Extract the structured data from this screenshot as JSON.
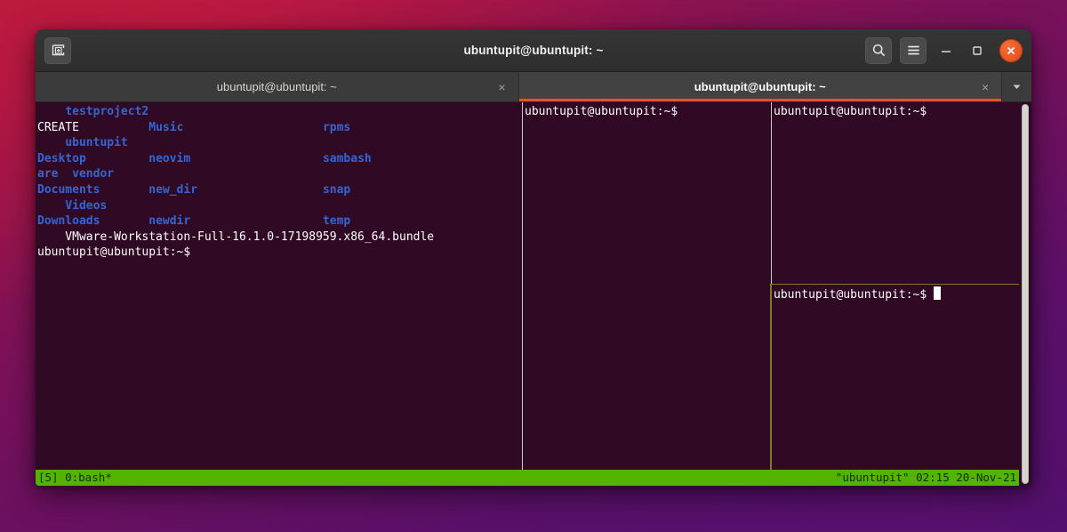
{
  "window": {
    "title": "ubuntupit@ubuntupit: ~",
    "accent_color": "#e95420",
    "bg_color": "#300a24",
    "headerbar_color": "#353535"
  },
  "headerbar": {
    "new_tab_label": "New Tab",
    "search_label": "Search",
    "menu_label": "Main Menu",
    "minimize_label": "Minimize",
    "maximize_label": "Maximize",
    "close_label": "Close"
  },
  "tabs": [
    {
      "label": "ubuntupit@ubuntupit: ~",
      "active": false,
      "close_label": "×"
    },
    {
      "label": "ubuntupit@ubuntupit: ~",
      "active": true,
      "close_label": "×"
    }
  ],
  "tab_list_button_label": "▾",
  "terminal": {
    "prompt": "ubuntupit@ubuntupit:~$",
    "left_pane": {
      "lines": [
        {
          "segments": [
            {
              "text": "    ",
              "class": "c-white"
            },
            {
              "text": "testproject2",
              "class": "c-blue"
            }
          ]
        },
        {
          "segments": [
            {
              "text": "CREATE",
              "class": "c-white"
            },
            {
              "text": "          ",
              "class": "c-white"
            },
            {
              "text": "Music",
              "class": "c-blue"
            },
            {
              "text": "                    ",
              "class": "c-white"
            },
            {
              "text": "rpms",
              "class": "c-blue"
            }
          ]
        },
        {
          "segments": [
            {
              "text": "    ",
              "class": "c-white"
            },
            {
              "text": "ubuntupit",
              "class": "c-blue"
            }
          ]
        },
        {
          "segments": [
            {
              "text": "Desktop",
              "class": "c-blue"
            },
            {
              "text": "         ",
              "class": "c-white"
            },
            {
              "text": "neovim",
              "class": "c-blue"
            },
            {
              "text": "                   ",
              "class": "c-white"
            },
            {
              "text": "sambash",
              "class": "c-blue"
            }
          ]
        },
        {
          "segments": [
            {
              "text": "are",
              "class": "c-blue"
            },
            {
              "text": "  ",
              "class": "c-white"
            },
            {
              "text": "vendor",
              "class": "c-blue"
            }
          ]
        },
        {
          "segments": [
            {
              "text": "Documents",
              "class": "c-blue"
            },
            {
              "text": "       ",
              "class": "c-white"
            },
            {
              "text": "new_dir",
              "class": "c-blue"
            },
            {
              "text": "                  ",
              "class": "c-white"
            },
            {
              "text": "snap",
              "class": "c-blue"
            }
          ]
        },
        {
          "segments": [
            {
              "text": "    ",
              "class": "c-white"
            },
            {
              "text": "Videos",
              "class": "c-blue"
            }
          ]
        },
        {
          "segments": [
            {
              "text": "Downloads",
              "class": "c-blue"
            },
            {
              "text": "       ",
              "class": "c-white"
            },
            {
              "text": "newdir",
              "class": "c-blue"
            },
            {
              "text": "                   ",
              "class": "c-white"
            },
            {
              "text": "temp",
              "class": "c-blue"
            }
          ]
        },
        {
          "segments": [
            {
              "text": "    VMware-Workstation-Full-16.1.0-17198959.x86_64.bundle",
              "class": "c-white"
            }
          ]
        },
        {
          "segments": [
            {
              "text": "ubuntupit@ubuntupit:~$",
              "class": "c-white"
            }
          ]
        }
      ]
    },
    "mid_pane": {
      "prompt": "ubuntupit@ubuntupit:~$"
    },
    "top_right_pane": {
      "prompt": "ubuntupit@ubuntupit:~$"
    },
    "bottom_right_pane": {
      "prompt": "ubuntupit@ubuntupit:~$",
      "has_cursor": true
    }
  },
  "tmux_status": {
    "left": "[5] 0:bash*",
    "right": "\"ubuntupit\" 02:15 20-Nov-21",
    "bg_color": "#53b400"
  },
  "scrollbar": {
    "label": "Scrollbar"
  }
}
